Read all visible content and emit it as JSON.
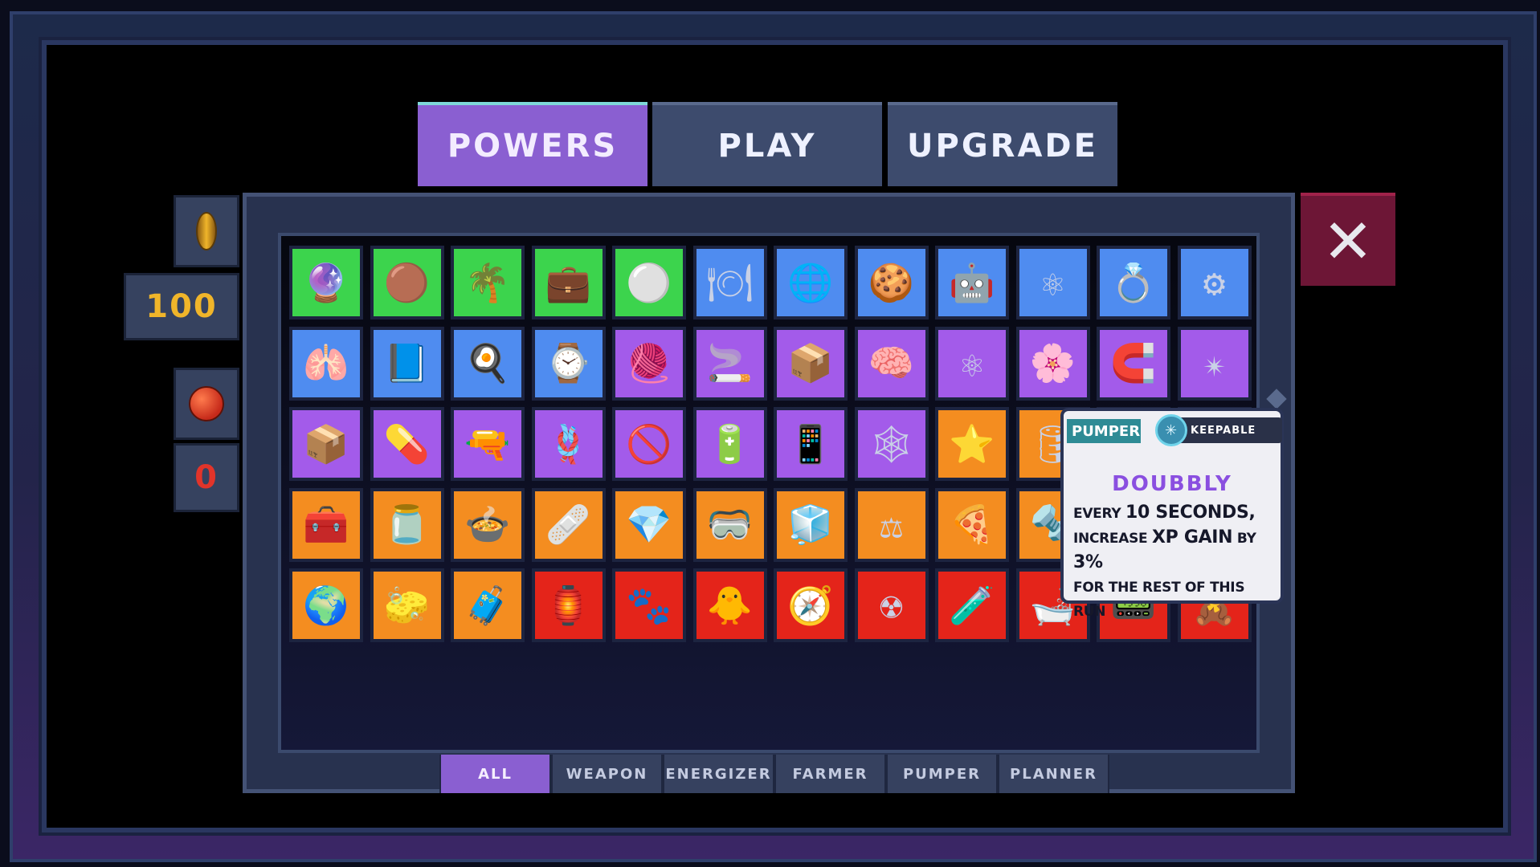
{
  "tabs": [
    {
      "label": "POWERS",
      "active": true
    },
    {
      "label": "PLAY",
      "active": false
    },
    {
      "label": "UPGRADE",
      "active": false
    }
  ],
  "resources": {
    "coin_icon": "gold-coin-icon",
    "coins": "100",
    "orb_icon": "red-orb-icon",
    "orbs": "0"
  },
  "close_label": "✕",
  "colors": {
    "green": "#3cd44d",
    "blue": "#4f8cf0",
    "purple": "#a35bea",
    "orange": "#f48d20",
    "red": "#e4241a",
    "accent": "#8a5fd1"
  },
  "grid": [
    [
      {
        "color": "green",
        "icon": "🔮"
      },
      {
        "color": "green",
        "icon": "🟤"
      },
      {
        "color": "green",
        "icon": "🌴"
      },
      {
        "color": "green",
        "icon": "💼"
      },
      {
        "color": "green",
        "icon": "⚪"
      },
      {
        "color": "blue",
        "icon": "🍽"
      },
      {
        "color": "blue",
        "icon": "🌐"
      },
      {
        "color": "blue",
        "icon": "🍪"
      },
      {
        "color": "blue",
        "icon": "🤖"
      },
      {
        "color": "blue",
        "icon": "⚛"
      },
      {
        "color": "blue",
        "icon": "💍"
      },
      {
        "color": "blue",
        "icon": "⚙"
      }
    ],
    [
      {
        "color": "blue",
        "icon": "🫁"
      },
      {
        "color": "blue",
        "icon": "📘"
      },
      {
        "color": "blue",
        "icon": "🍳"
      },
      {
        "color": "blue",
        "icon": "⌚"
      },
      {
        "color": "purple",
        "icon": "🧶"
      },
      {
        "color": "purple",
        "icon": "🚬"
      },
      {
        "color": "purple",
        "icon": "📦"
      },
      {
        "color": "purple",
        "icon": "🧠"
      },
      {
        "color": "purple",
        "icon": "⚛"
      },
      {
        "color": "purple",
        "icon": "🌸"
      },
      {
        "color": "purple",
        "icon": "🧲"
      },
      {
        "color": "purple",
        "icon": "✴"
      }
    ],
    [
      {
        "color": "purple",
        "icon": "📦"
      },
      {
        "color": "purple",
        "icon": "💊"
      },
      {
        "color": "purple",
        "icon": "🔫"
      },
      {
        "color": "purple",
        "icon": "🪢"
      },
      {
        "color": "purple",
        "icon": "🚫"
      },
      {
        "color": "purple",
        "icon": "🔋"
      },
      {
        "color": "purple",
        "icon": "📱"
      },
      {
        "color": "purple",
        "icon": "🕸"
      },
      {
        "color": "orange",
        "icon": "⭐"
      },
      {
        "color": "orange",
        "icon": "🛢"
      },
      {
        "color": "orange",
        "icon": ""
      },
      {
        "color": "orange",
        "icon": ""
      }
    ],
    [
      {
        "color": "orange",
        "icon": "🧰"
      },
      {
        "color": "orange",
        "icon": "🫙"
      },
      {
        "color": "orange",
        "icon": "🍲"
      },
      {
        "color": "orange",
        "icon": "🩹"
      },
      {
        "color": "orange",
        "icon": "💎"
      },
      {
        "color": "orange",
        "icon": "🥽"
      },
      {
        "color": "orange",
        "icon": "🧊"
      },
      {
        "color": "orange",
        "icon": "⚖"
      },
      {
        "color": "orange",
        "icon": "🍕"
      },
      {
        "color": "orange",
        "icon": "🔩"
      },
      {
        "color": "orange",
        "icon": ""
      },
      {
        "color": "orange",
        "icon": ""
      }
    ],
    [
      {
        "color": "orange",
        "icon": "🌍"
      },
      {
        "color": "orange",
        "icon": "🧽"
      },
      {
        "color": "orange",
        "icon": "🧳"
      },
      {
        "color": "red",
        "icon": "🏮"
      },
      {
        "color": "red",
        "icon": "🐾"
      },
      {
        "color": "red",
        "icon": "🐥"
      },
      {
        "color": "red",
        "icon": "🧭"
      },
      {
        "color": "red",
        "icon": "☢"
      },
      {
        "color": "red",
        "icon": "🧪"
      },
      {
        "color": "red",
        "icon": "🛁"
      },
      {
        "color": "red",
        "icon": "📟"
      },
      {
        "color": "red",
        "icon": "🧸"
      }
    ]
  ],
  "filters": [
    {
      "label": "ALL",
      "active": true
    },
    {
      "label": "WEAPON",
      "active": false
    },
    {
      "label": "ENERGIZER",
      "active": false
    },
    {
      "label": "FARMER",
      "active": false
    },
    {
      "label": "PUMPER",
      "active": false
    },
    {
      "label": "PLANNER",
      "active": false
    }
  ],
  "tooltip": {
    "category": "PUMPER",
    "keep_label": "KEEPABLE",
    "name": "DOUBBLY",
    "line1_a": "EVERY ",
    "line1_b": "10 SECONDS,",
    "line2_a": "INCREASE ",
    "line2_b": "XP GAIN",
    "line2_c": " BY ",
    "line2_d": "3%",
    "line3": "FOR THE REST OF THIS RUN"
  }
}
